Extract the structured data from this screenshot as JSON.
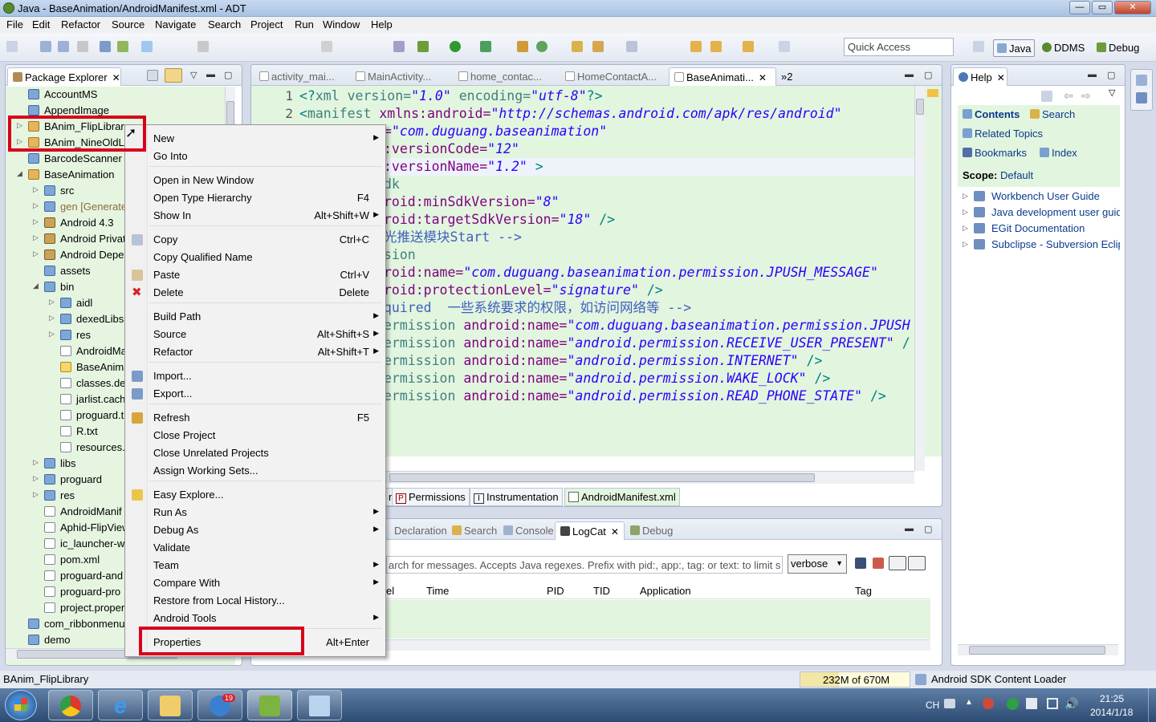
{
  "window": {
    "title": "Java - BaseAnimation/AndroidManifest.xml - ADT",
    "minimize": "—",
    "maximize": "▭",
    "close": "✕"
  },
  "menubar": [
    "File",
    "Edit",
    "Refactor",
    "Source",
    "Navigate",
    "Search",
    "Project",
    "Run",
    "Window",
    "Help"
  ],
  "toolbar": {
    "quick_access": "Quick Access",
    "perspectives": [
      "Java",
      "DDMS",
      "Debug"
    ]
  },
  "package_explorer": {
    "title": "Package Explorer",
    "items": [
      "AccountMS",
      "AppendImage",
      "BAnim_FlipLibrary",
      "BAnim_NineOldLi",
      "BarcodeScanner",
      "BaseAnimation",
      "src",
      "gen [Generate",
      "Android 4.3",
      "Android Privat",
      "Android Depe",
      "assets",
      "bin",
      "aidl",
      "dexedLibs",
      "res",
      "AndroidMa",
      "BaseAnima",
      "classes.dex",
      "jarlist.cache",
      "proguard.t",
      "R.txt",
      "resources.a",
      "libs",
      "proguard",
      "res",
      "AndroidManif",
      "Aphid-FlipView",
      "ic_launcher-we",
      "pom.xml",
      "proguard-and",
      "proguard-pro",
      "project.proper",
      "com_ribbonmenu",
      "demo"
    ]
  },
  "editor": {
    "tabs": [
      "activity_mai...",
      "MainActivity...",
      "home_contac...",
      "HomeContactA...",
      "BaseAnimati...",
      "»2"
    ],
    "line_numbers": [
      "1",
      "2"
    ],
    "lines": [
      [
        "<?",
        "xml version=",
        "\"1.0\"",
        " encoding=",
        "\"utf-8\"",
        "?>"
      ],
      [
        "<",
        "manifest",
        " xmlns:android=",
        "\"http://schemas.android.com/apk/res/android\""
      ],
      [
        "=",
        "\"com.duguang.baseanimation\""
      ],
      [
        ":versionCode=",
        "\"12\""
      ],
      [
        ":versionName=",
        "\"1.2\"",
        " >"
      ],
      [
        "dk"
      ],
      [
        "roid:minSdkVersion=",
        "\"8\""
      ],
      [
        "roid:targetSdkVersion=",
        "\"18\"",
        " />"
      ],
      [
        "光推送模块Start -->"
      ],
      [
        "sion"
      ],
      [
        "roid:name=",
        "\"com.duguang.baseanimation.permission.JPUSH_MESSAGE\""
      ],
      [
        "roid:protectionLevel=",
        "\"signature\"",
        " />"
      ],
      [
        "quired  一些系统要求的权限，如访问网络等 -->"
      ],
      [
        "ermission",
        " android:name=",
        "\"com.duguang.baseanimation.permission.JPUSH"
      ],
      [
        "ermission",
        " android:name=",
        "\"android.permission.RECEIVE_USER_PRESENT\"",
        " /"
      ],
      [
        "ermission",
        " android:name=",
        "\"android.permission.INTERNET\"",
        " />"
      ],
      [
        "ermission",
        " android:name=",
        "\"android.permission.WAKE_LOCK\"",
        " />"
      ],
      [
        "ermission",
        " android:name=",
        "\"android.permission.READ_PHONE_STATE\"",
        " />"
      ]
    ],
    "bottom_tabs": [
      "n",
      "Permissions",
      "Instrumentation",
      "AndroidManifest.xml"
    ]
  },
  "context_menu": {
    "items": [
      {
        "label": "New",
        "shortcut": "",
        "sub": true
      },
      {
        "label": "Go Into",
        "shortcut": "",
        "sub": false
      },
      {
        "label": "Open in New Window",
        "shortcut": "",
        "sub": false
      },
      {
        "label": "Open Type Hierarchy",
        "shortcut": "F4",
        "sub": false
      },
      {
        "label": "Show In",
        "shortcut": "Alt+Shift+W",
        "sub": true
      },
      {
        "label": "Copy",
        "shortcut": "Ctrl+C",
        "sub": false
      },
      {
        "label": "Copy Qualified Name",
        "shortcut": "",
        "sub": false
      },
      {
        "label": "Paste",
        "shortcut": "Ctrl+V",
        "sub": false
      },
      {
        "label": "Delete",
        "shortcut": "Delete",
        "sub": false
      },
      {
        "label": "Build Path",
        "shortcut": "",
        "sub": true
      },
      {
        "label": "Source",
        "shortcut": "Alt+Shift+S",
        "sub": true
      },
      {
        "label": "Refactor",
        "shortcut": "Alt+Shift+T",
        "sub": true
      },
      {
        "label": "Import...",
        "shortcut": "",
        "sub": false
      },
      {
        "label": "Export...",
        "shortcut": "",
        "sub": false
      },
      {
        "label": "Refresh",
        "shortcut": "F5",
        "sub": false
      },
      {
        "label": "Close Project",
        "shortcut": "",
        "sub": false
      },
      {
        "label": "Close Unrelated Projects",
        "shortcut": "",
        "sub": false
      },
      {
        "label": "Assign Working Sets...",
        "shortcut": "",
        "sub": false
      },
      {
        "label": "Easy Explore...",
        "shortcut": "",
        "sub": false
      },
      {
        "label": "Run As",
        "shortcut": "",
        "sub": true
      },
      {
        "label": "Debug As",
        "shortcut": "",
        "sub": true
      },
      {
        "label": "Validate",
        "shortcut": "",
        "sub": false
      },
      {
        "label": "Team",
        "shortcut": "",
        "sub": true
      },
      {
        "label": "Compare With",
        "shortcut": "",
        "sub": true
      },
      {
        "label": "Restore from Local History...",
        "shortcut": "",
        "sub": false
      },
      {
        "label": "Android Tools",
        "shortcut": "",
        "sub": true
      },
      {
        "label": "Properties",
        "shortcut": "Alt+Enter",
        "sub": false
      }
    ]
  },
  "console": {
    "tabs": [
      "Declaration",
      "Search",
      "Console",
      "LogCat",
      "Debug"
    ],
    "filter_placeholder": "arch for messages. Accepts Java regexes. Prefix with pid:, app:, tag: or text: to limit s",
    "level": "verbose",
    "columns": [
      "el",
      "Time",
      "PID",
      "TID",
      "Application",
      "Tag"
    ]
  },
  "help": {
    "title": "Help",
    "nav": [
      "Contents",
      "Search",
      "Related Topics",
      "Bookmarks",
      "Index"
    ],
    "scope_label": "Scope:",
    "scope_value": "Default",
    "books": [
      "Workbench User Guide",
      "Java development user guid",
      "EGit Documentation",
      "Subclipse - Subversion Eclip"
    ]
  },
  "statusbar": {
    "selection": "BAnim_FlipLibrary",
    "heap": "232M of 670M",
    "task": "Android SDK Content Loader"
  },
  "taskbar": {
    "badge": "19",
    "tray_lang": "CH",
    "time": "21:25",
    "date": "2014/1/18"
  },
  "colors": {
    "editor_bg": "#e2f5df",
    "tree_bg": "#e6f5e0",
    "highlight": "#d8001a"
  }
}
